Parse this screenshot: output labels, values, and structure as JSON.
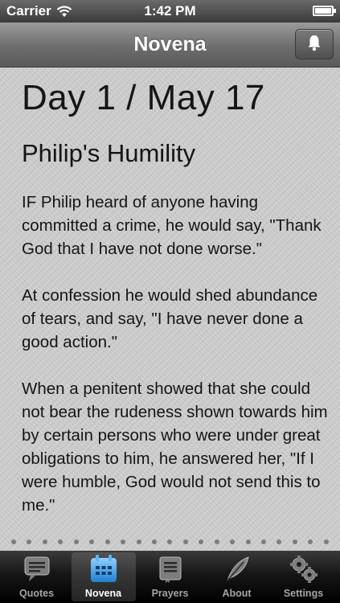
{
  "status_bar": {
    "carrier": "Carrier",
    "time": "1:42 PM"
  },
  "nav": {
    "title": "Novena",
    "right_icon": "bell-icon"
  },
  "reading": {
    "day_heading": "Day 1 / May 17",
    "title": "Philip's Humility",
    "paragraphs": [
      "IF Philip heard of anyone having committed a crime, he would say, \"Thank God that I have not done worse.\"",
      "At confession he would shed abundance of tears, and say, \"I have never done a good action.\"",
      "When a penitent showed that she could not bear the rudeness shown towards him by certain persons who were under great obligations to him, he answered her, \"If I were humble, God would not send this to me.\""
    ]
  },
  "tabs": [
    {
      "label": "Quotes",
      "icon": "speech-bubble-icon",
      "active": false
    },
    {
      "label": "Novena",
      "icon": "calendar-icon",
      "active": true
    },
    {
      "label": "Prayers",
      "icon": "book-icon",
      "active": false
    },
    {
      "label": "About",
      "icon": "feather-icon",
      "active": false
    },
    {
      "label": "Settings",
      "icon": "gears-icon",
      "active": false
    }
  ],
  "colors": {
    "active_tab_icon": "#3ea1e8",
    "inactive_tab_icon": "#8a8a8a",
    "content_bg": "#cecece"
  }
}
